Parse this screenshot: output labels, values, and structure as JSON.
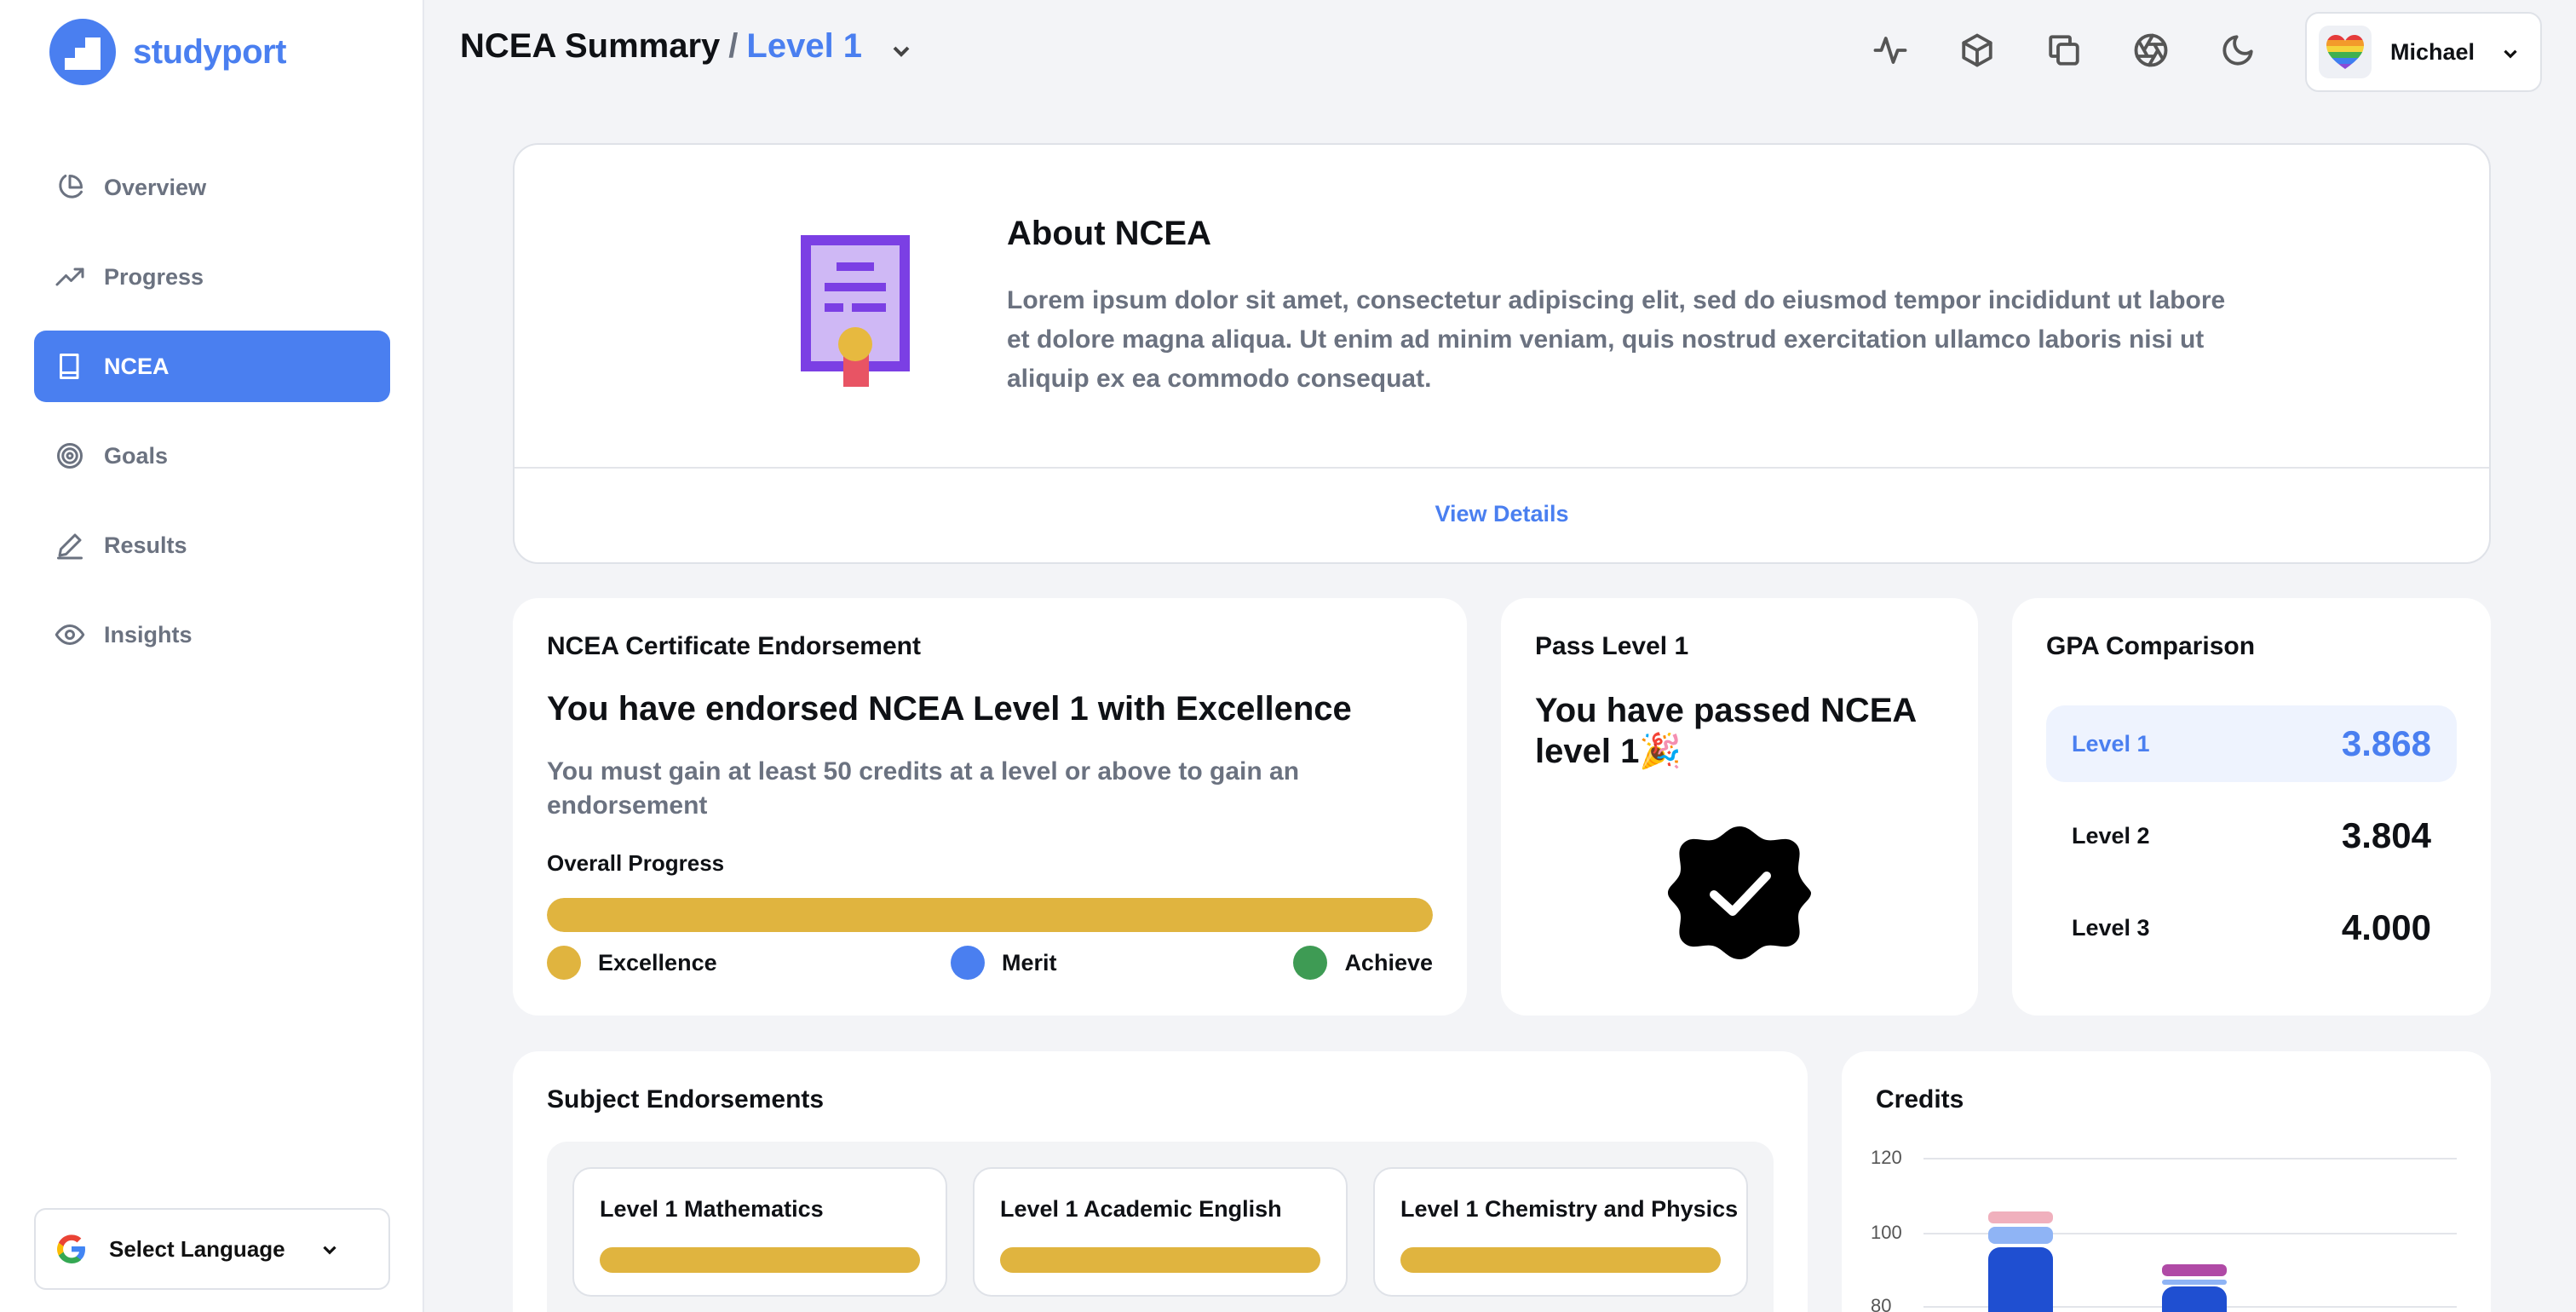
{
  "brand": {
    "name": "studyport"
  },
  "sidebar": {
    "items": [
      {
        "label": "Overview",
        "icon": "pie-chart-icon"
      },
      {
        "label": "Progress",
        "icon": "trending-up-icon"
      },
      {
        "label": "NCEA",
        "icon": "book-icon",
        "active": true
      },
      {
        "label": "Goals",
        "icon": "target-icon"
      },
      {
        "label": "Results",
        "icon": "pen-icon"
      },
      {
        "label": "Insights",
        "icon": "eye-icon"
      }
    ],
    "language": {
      "label": "Select Language"
    }
  },
  "header": {
    "title": "NCEA Summary",
    "separator": "/",
    "level": "Level 1",
    "toolbar_icons": [
      "activity-icon",
      "box-icon",
      "copy-icon",
      "aperture-icon",
      "moon-icon"
    ],
    "user": {
      "name": "Michael"
    }
  },
  "about": {
    "title": "About NCEA",
    "text": "Lorem ipsum dolor sit amet, consectetur adipiscing elit, sed do eiusmod tempor incididunt ut labore et dolore magna aliqua. Ut enim ad minim veniam, quis nostrud exercitation ullamco laboris nisi ut aliquip ex ea commodo consequat.",
    "link": "View Details"
  },
  "endorsement": {
    "heading": "NCEA Certificate Endorsement",
    "title": "You have endorsed NCEA Level 1 with Excellence",
    "subtitle": "You must gain at least 50 credits at a level or above to gain an endorsement",
    "progress_label": "Overall Progress",
    "progress": 1.0,
    "legend": [
      {
        "label": "Excellence",
        "color": "#e0b43f"
      },
      {
        "label": "Merit",
        "color": "#4a7ff0"
      },
      {
        "label": "Achieve",
        "color": "#3e9b54"
      }
    ]
  },
  "pass": {
    "heading": "Pass Level 1",
    "title": "You have passed NCEA level 1🎉"
  },
  "gpa": {
    "heading": "GPA Comparison",
    "rows": [
      {
        "label": "Level 1",
        "value": "3.868",
        "highlight": true
      },
      {
        "label": "Level 2",
        "value": "3.804"
      },
      {
        "label": "Level 3",
        "value": "4.000"
      }
    ]
  },
  "subjects": {
    "heading": "Subject Endorsements",
    "items": [
      {
        "title": "Level 1 Mathematics",
        "progress": 1.0
      },
      {
        "title": "Level 1 Academic English",
        "progress": 1.0
      },
      {
        "title": "Level 1 Chemistry and Physics",
        "progress": 1.0
      }
    ]
  },
  "credits": {
    "heading": "Credits",
    "chart_data": {
      "type": "bar",
      "y_ticks": [
        "120",
        "100",
        "80"
      ],
      "ylim": [
        80,
        120
      ],
      "colors": {
        "excellence": "#1f4fd1",
        "merit": "#8fb4f5",
        "achieve": "#f0b0bd",
        "alt": "#b04aa6"
      }
    }
  },
  "colors": {
    "accent": "#4a7ff0",
    "gold": "#e0b43f"
  }
}
